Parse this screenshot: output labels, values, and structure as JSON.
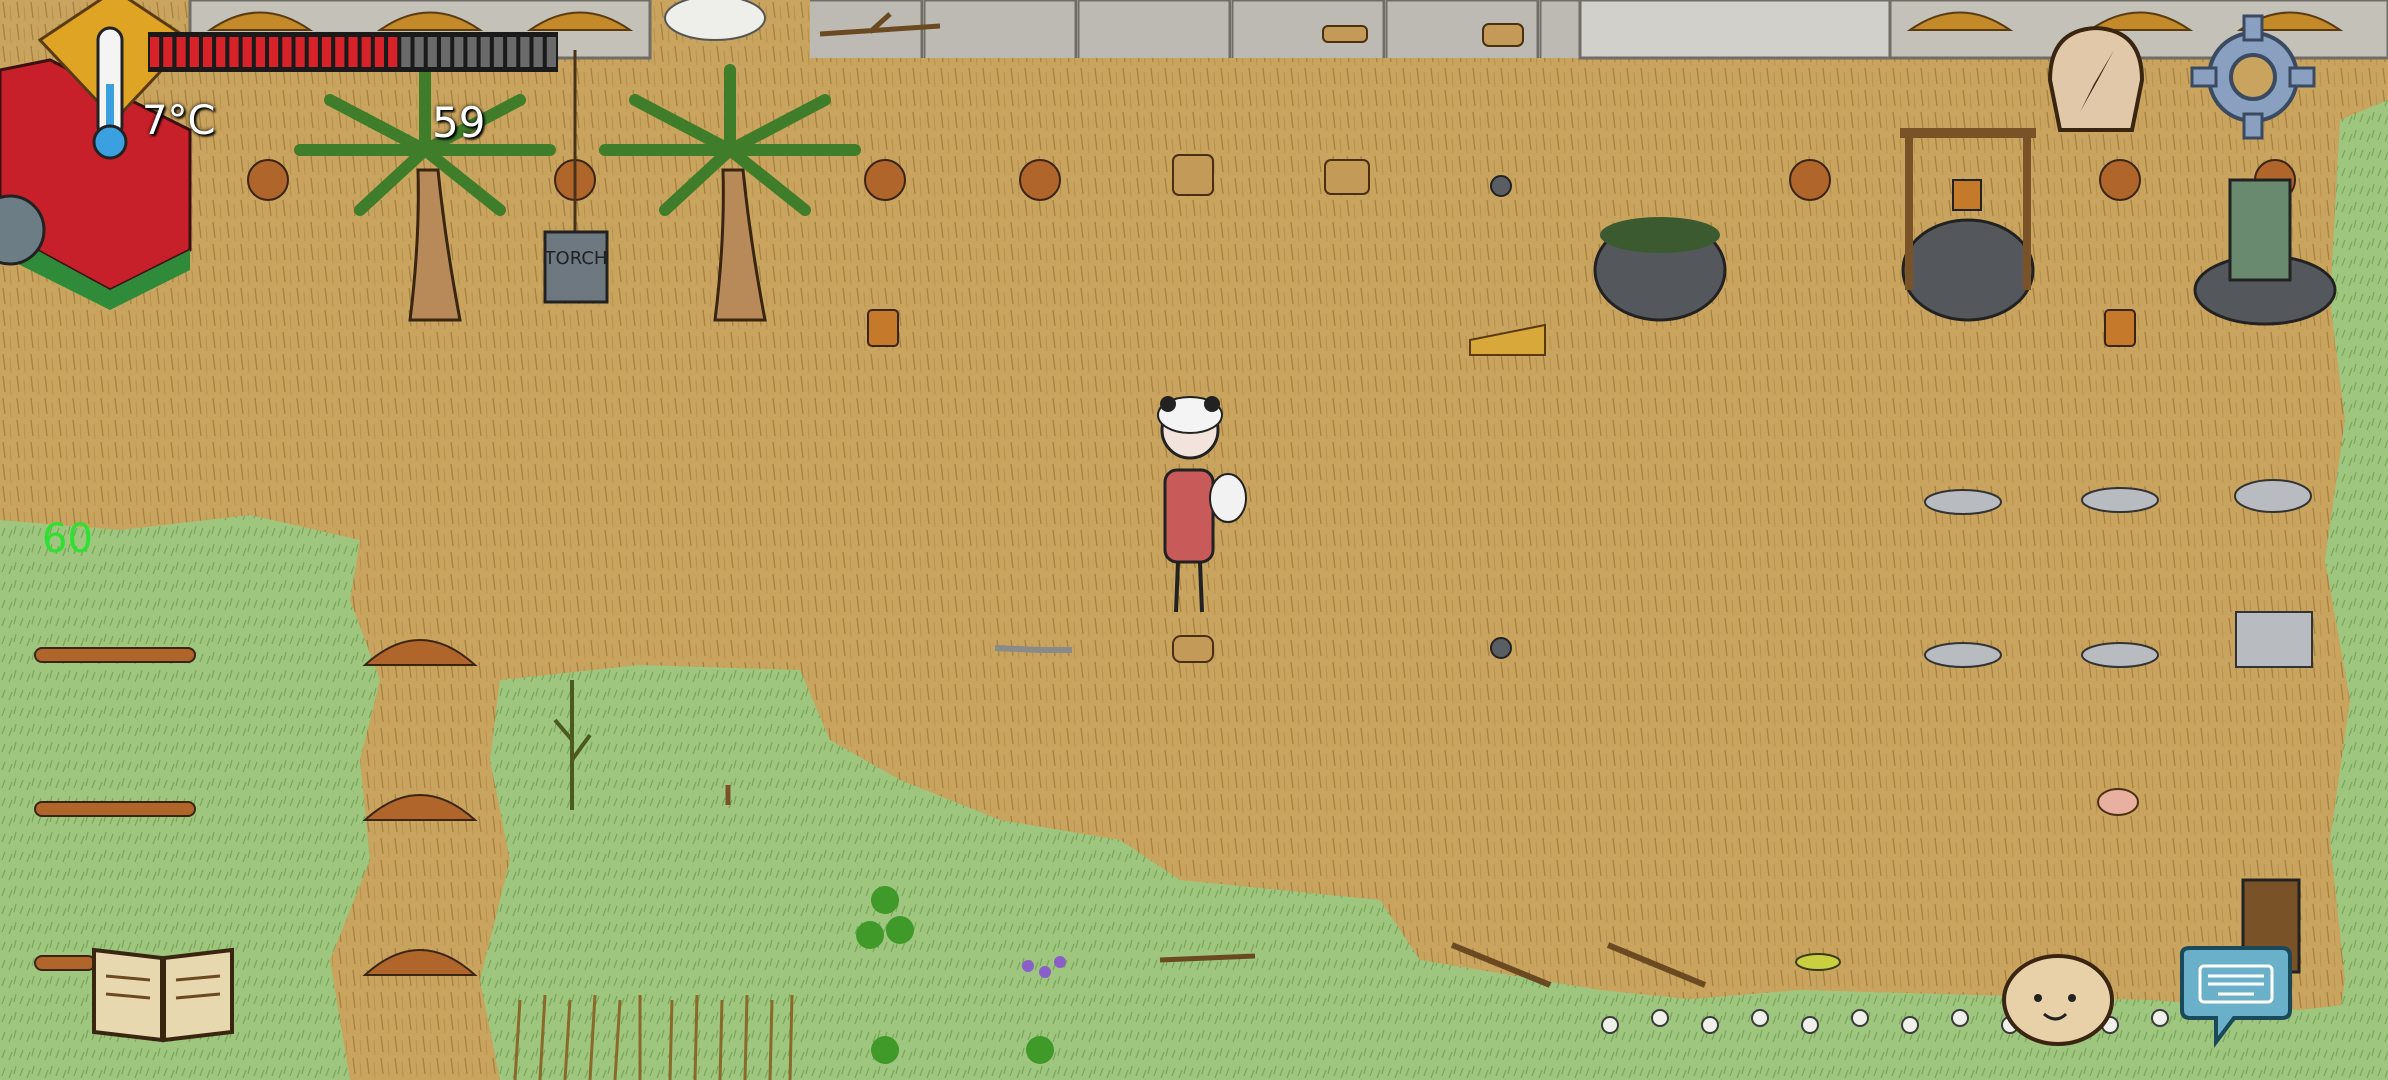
{
  "hud": {
    "temperature": "7°C",
    "food_yum": "59",
    "fps": "60",
    "food_meter": {
      "filled_pips": 19,
      "total_pips": 31
    },
    "player_tag": "",
    "torch_sign": "TORCH"
  },
  "buttons": {
    "compass": "compass-icon",
    "settings": "gear-icon",
    "tech_tree": "book-icon",
    "emote": "smiley-face-icon",
    "chat": "keyboard-chat-icon"
  },
  "colors": {
    "dry_ground": "#c9a45e",
    "grass": "#9fc77e",
    "food_red": "#d8222a",
    "food_empty": "#6a6a6a",
    "fps_green": "#30e030"
  }
}
